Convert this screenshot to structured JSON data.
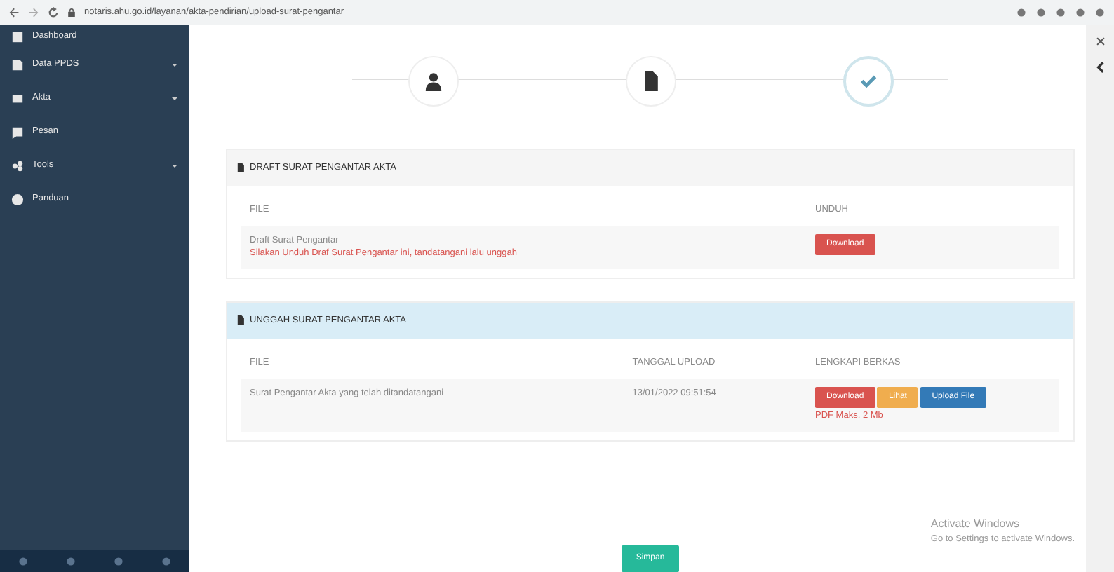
{
  "browser": {
    "url": "notaris.ahu.go.id/layanan/akta-pendirian/upload-surat-pengantar"
  },
  "sidebar": {
    "items": [
      {
        "label": "Dashboard",
        "has_children": false
      },
      {
        "label": "Data PPDS",
        "has_children": true
      },
      {
        "label": "Akta",
        "has_children": true
      },
      {
        "label": "Pesan",
        "has_children": false
      },
      {
        "label": "Tools",
        "has_children": true
      },
      {
        "label": "Panduan",
        "has_children": false
      }
    ]
  },
  "stepper": {
    "steps": [
      {
        "selected": false
      },
      {
        "selected": false
      },
      {
        "selected": true
      }
    ]
  },
  "draft_panel": {
    "title": "DRAFT SURAT PENGANTAR AKTA",
    "columns": [
      "FILE",
      "UNDUH"
    ],
    "rows": [
      {
        "file": "Draft Surat Pengantar",
        "note": "Silakan Unduh Draf Surat Pengantar ini, tandatangani lalu unggah",
        "button": "Download"
      }
    ]
  },
  "upload_panel": {
    "title": "UNGGAH SURAT PENGANTAR AKTA",
    "columns": [
      "FILE",
      "TANGGAL UPLOAD",
      "LENGKAPI BERKAS"
    ],
    "rows": [
      {
        "file": "Surat Pengantar Akta yang telah ditandatangani",
        "date": "13/01/2022 09:51:54",
        "buttons": [
          {
            "label": "Download",
            "kind": "danger"
          },
          {
            "label": "Lihat",
            "kind": "warning"
          },
          {
            "label": "Upload File",
            "kind": "primary"
          }
        ],
        "hint": "PDF Maks. 2 Mb"
      }
    ]
  },
  "submit_button": "Simpan",
  "os_notice": {
    "title": "Activate Windows",
    "text": "Go to Settings to activate Windows."
  }
}
